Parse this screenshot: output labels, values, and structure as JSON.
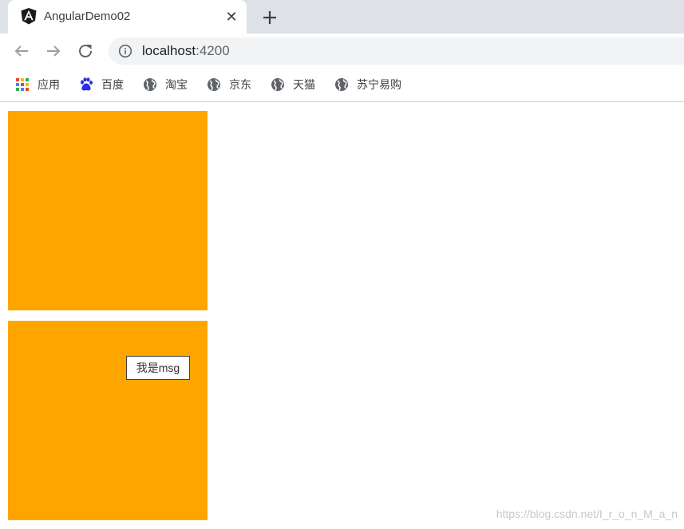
{
  "browser": {
    "tab": {
      "title": "AngularDemo02",
      "close": "✕"
    },
    "address": {
      "host": "localhost",
      "port": ":4200"
    },
    "bookmarks": [
      {
        "label": "应用",
        "icon": "apps-grid-icon"
      },
      {
        "label": "百度",
        "icon": "baidu-paw-icon"
      },
      {
        "label": "淘宝",
        "icon": "globe-icon"
      },
      {
        "label": "京东",
        "icon": "globe-icon"
      },
      {
        "label": "天猫",
        "icon": "globe-icon"
      },
      {
        "label": "苏宁易购",
        "icon": "globe-icon"
      }
    ]
  },
  "page": {
    "box_color": "#ffa500",
    "msg": "我是msg",
    "watermark": "https://blog.csdn.net/I_r_o_n_M_a_n"
  }
}
